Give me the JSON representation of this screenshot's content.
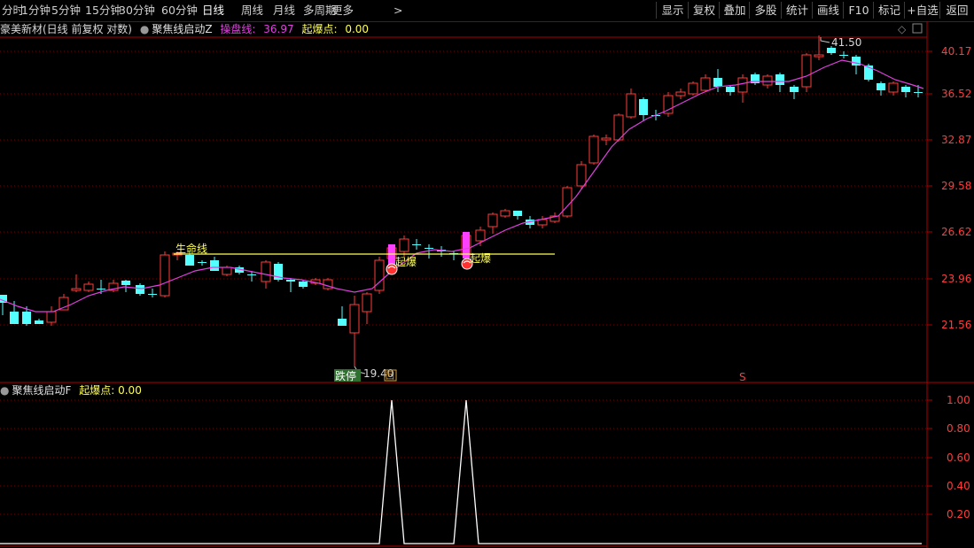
{
  "toolbar": {
    "periods": [
      "分时",
      "1分钟",
      "5分钟",
      "15分钟",
      "30分钟",
      "60分钟",
      "日线",
      "周线",
      "月线",
      "多周期",
      "更多"
    ],
    "active_period": "日线",
    "right_buttons": [
      "显示",
      "复权",
      "叠加",
      "多股",
      "统计",
      "画线",
      "F10",
      "标记",
      "+自选",
      "返回"
    ]
  },
  "main_info": {
    "stock_text": "豪美新材(日线 前复权 对数)",
    "indicator_name": "聚焦线启动Z",
    "line_label": "操盘线",
    "line_value": "36.97",
    "point_label": "起爆点",
    "point_value": "0.00"
  },
  "sub_info": {
    "indicator_name": "聚焦线启动F",
    "point_label": "起爆点",
    "point_value": "0.00"
  },
  "price_axis": [
    "40.17",
    "36.52",
    "32.87",
    "29.58",
    "26.62",
    "23.96",
    "21.56"
  ],
  "sub_axis": [
    "1.00",
    "0.80",
    "0.60",
    "0.40",
    "0.20"
  ],
  "annotations": {
    "lifeline_label": "生命线",
    "burst_label": "起爆",
    "high_label": "41.50",
    "low_label": "19.40",
    "limit_down_label": "跌停",
    "back_label": "回",
    "marker_s": "S"
  },
  "colors": {
    "up": "#ff3c3c",
    "down": "#54ffff",
    "ma": "#e040e0",
    "lifeline": "#ffff55",
    "axis_red": "#b00000"
  }
}
